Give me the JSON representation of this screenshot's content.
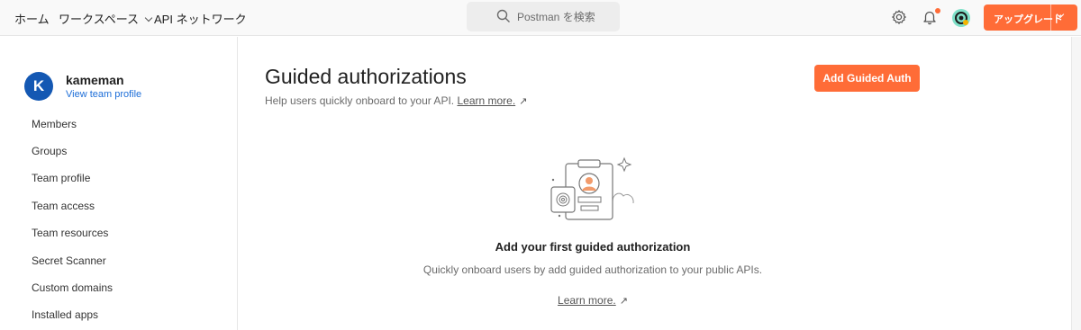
{
  "topbar": {
    "nav": [
      "ホーム",
      "ワークスペース",
      "API ネットワーク"
    ],
    "search_placeholder": "Postman を検索",
    "upgrade_label": "アップグレード",
    "icons": [
      "settings-gear-icon",
      "notification-bell-icon",
      "user-avatar-icon"
    ],
    "notification_color": "#ff6c37"
  },
  "sidebar": {
    "team_name": "kameman",
    "team_link": "View team profile",
    "avatar_letter": "K",
    "items": [
      "Members",
      "Groups",
      "Team profile",
      "Team access",
      "Team resources",
      "Secret Scanner",
      "Custom domains",
      "Installed apps"
    ]
  },
  "main": {
    "title": "Guided authorizations",
    "subtitle": "Help users quickly onboard to your API.",
    "subtitle_link": "Learn more.",
    "add_button": "Add Guided Auth",
    "empty_title": "Add your first guided authorization",
    "empty_desc": "Quickly onboard users by add guided authorization to your public APIs.",
    "empty_link": "Learn more."
  },
  "colors": {
    "accent": "#ff6c37",
    "link": "#1d6ed8",
    "avatar": "#1458b3"
  }
}
